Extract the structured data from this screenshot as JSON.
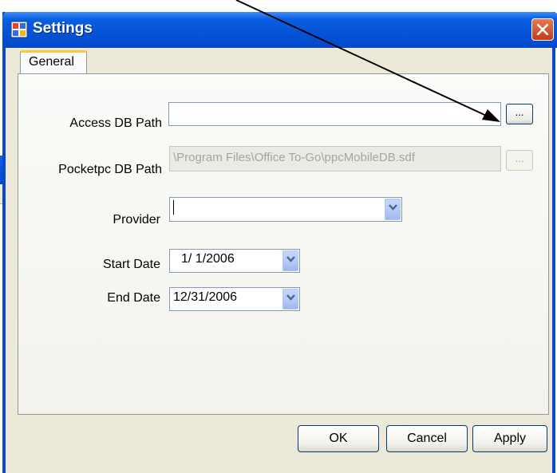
{
  "background_window": {
    "close_glyph": "✕"
  },
  "window": {
    "title": "Settings",
    "close_glyph": "✕"
  },
  "tabs": [
    {
      "label": "General"
    }
  ],
  "form": {
    "access_db_path": {
      "label": "Access DB Path",
      "value": "",
      "browse_label": "..."
    },
    "pocketpc_db_path": {
      "label": "Pocketpc DB Path",
      "value": "\\Program Files\\Office To-Go\\ppcMobileDB.sdf",
      "browse_label": "...",
      "disabled": true
    },
    "provider": {
      "label": "Provider",
      "value": ""
    },
    "start_date": {
      "label": "Start Date",
      "value": "1/ 1/2006"
    },
    "end_date": {
      "label": "End Date",
      "value": "12/31/2006"
    }
  },
  "buttons": {
    "ok": "OK",
    "cancel": "Cancel",
    "apply": "Apply"
  },
  "colors": {
    "titlebar": "#0553d7",
    "dialog_face": "#ece9d8",
    "close_button": "#c33a1c",
    "tab_highlight": "#ffc83c"
  },
  "icons": {
    "app": "settings-window-icon",
    "close": "close-icon",
    "dropdown": "chevron-down-icon"
  }
}
